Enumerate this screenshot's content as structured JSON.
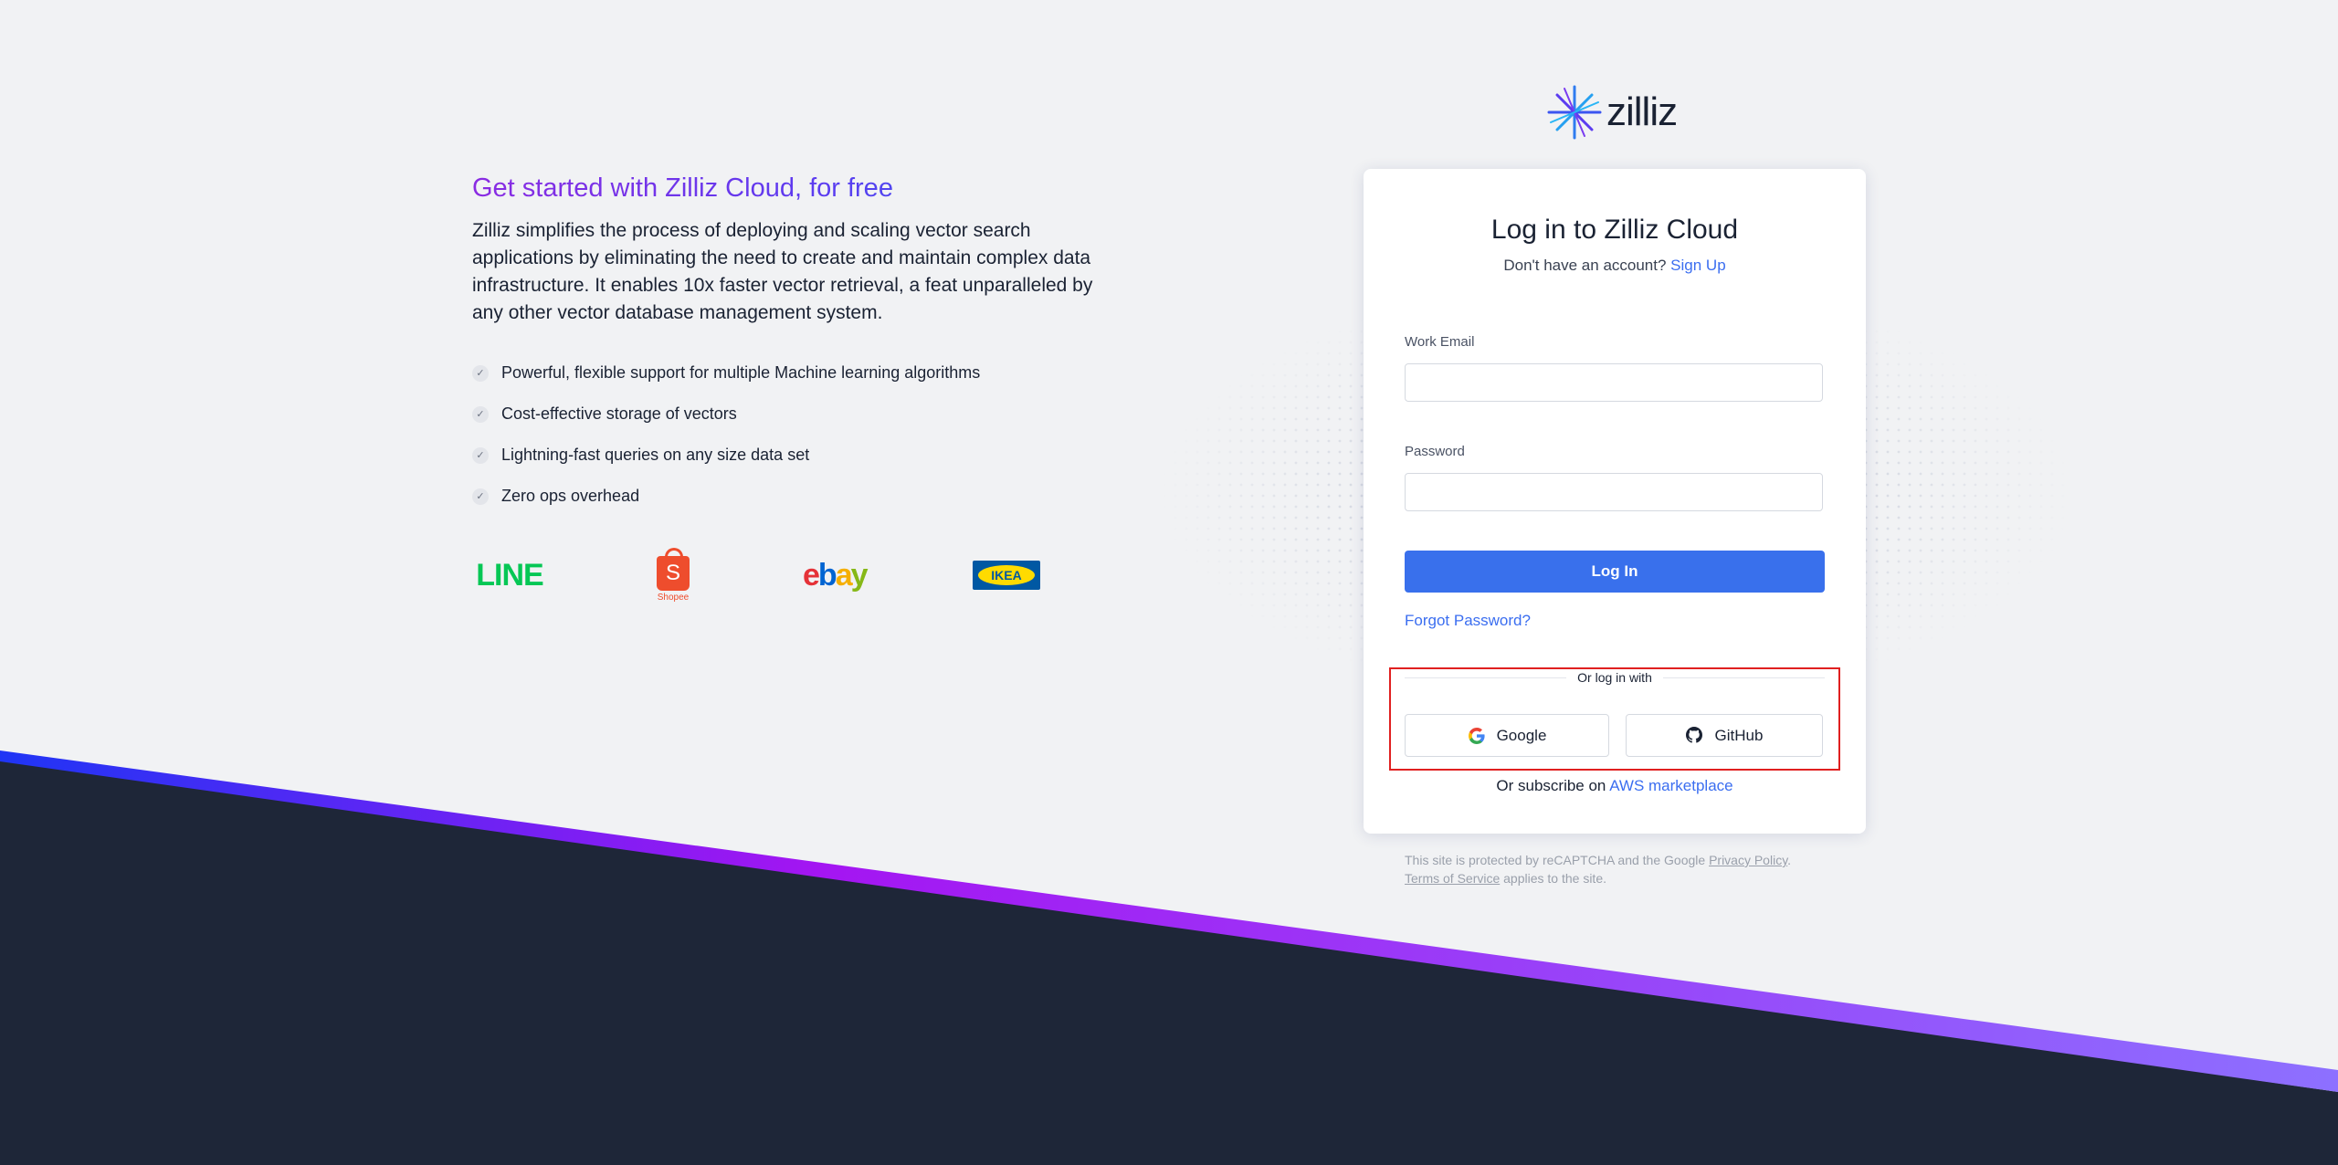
{
  "hero": {
    "headline": "Get started with Zilliz Cloud, for free",
    "lead": "Zilliz simplifies the process of deploying and scaling vector search applications by eliminating the need to create and maintain complex data infrastructure. It enables 10x faster vector retrieval, a feat unparalleled by any other vector database management system.",
    "features": [
      "Powerful, flexible support for multiple Machine learning algorithms",
      "Cost-effective storage of vectors",
      "Lightning-fast queries on any size data set",
      "Zero ops overhead"
    ],
    "customer_logos": {
      "line": "LINE",
      "shopee_glyph": "S",
      "shopee": "Shopee",
      "ebay": [
        "e",
        "b",
        "a",
        "y"
      ],
      "ikea": "IKEA"
    }
  },
  "brand": {
    "name": "zilliz",
    "icon": "zilliz-starburst-icon"
  },
  "login": {
    "title": "Log in to Zilliz Cloud",
    "no_account": "Don't have an account?",
    "signup_link": "Sign Up",
    "email_label": "Work Email",
    "email_value": "",
    "password_label": "Password",
    "password_value": "",
    "login_button": "Log In",
    "forgot_link": "Forgot Password?",
    "or_text": "Or log in with",
    "google_button": "Google",
    "github_button": "GitHub",
    "subscribe_text": "Or subscribe on",
    "aws_link": "AWS marketplace"
  },
  "recaptcha": {
    "prefix": "This site is protected by reCAPTCHA and the Google",
    "privacy": "Privacy Policy",
    "terms": "Terms of Service",
    "suffix": "applies to the site."
  },
  "colors": {
    "accent": "#3970ec",
    "link": "#3b6ef0",
    "dark_band": "#1e2638",
    "stripe_start": "#1f35f5",
    "stripe_mid": "#a415f2",
    "stripe_end": "#8d70ff",
    "highlight": "#e02020"
  }
}
